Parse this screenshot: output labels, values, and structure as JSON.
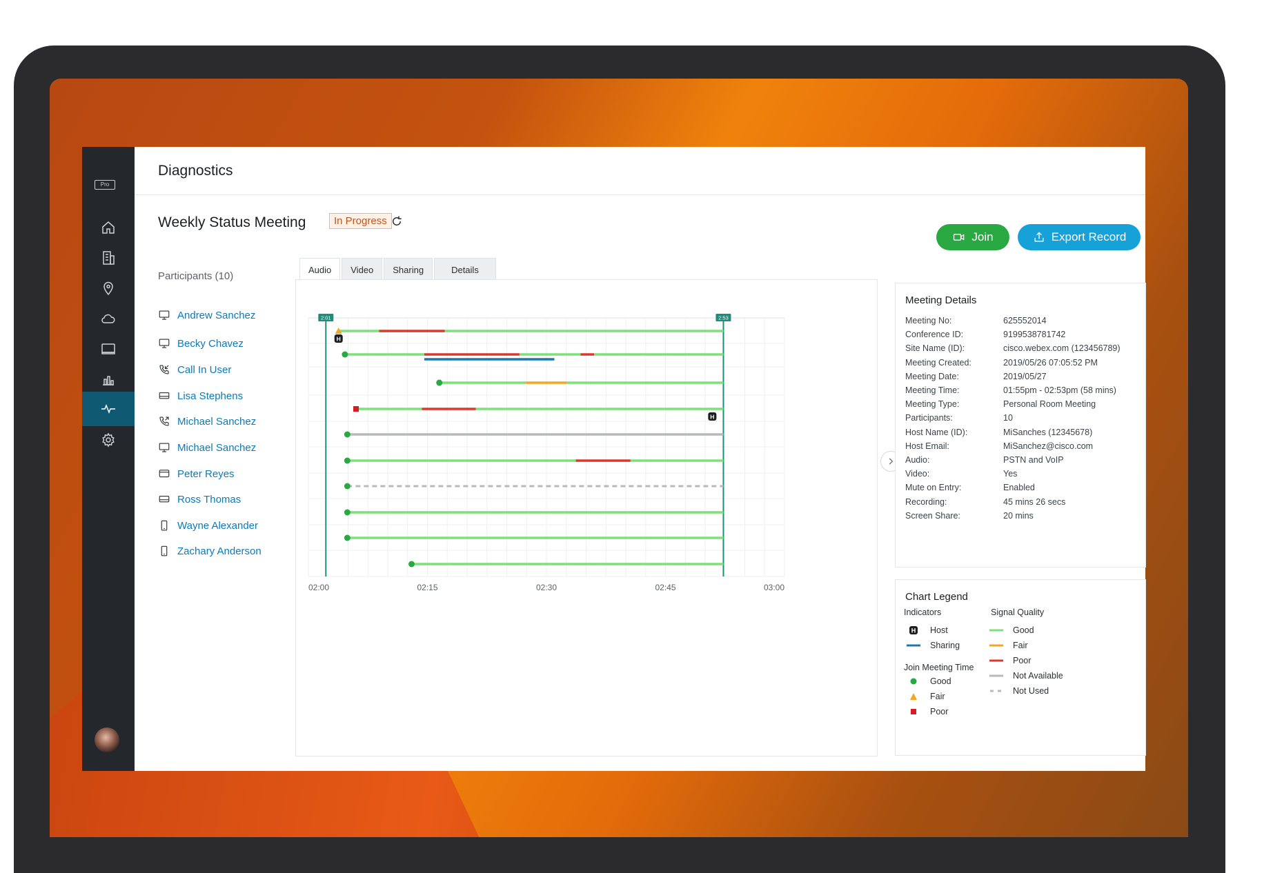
{
  "colors": {
    "good": "#7ee07a",
    "fair": "#f5a623",
    "poor": "#d73a2f",
    "not_available": "#b7b9bc",
    "sharing": "#1d77b0",
    "join_good": "#2aa841",
    "join_poor": "#d71c24",
    "marker": "#1f8c7c",
    "accent_blue": "#0d7ab8",
    "join_button": "#2aa841",
    "export_button": "#16a1d8",
    "nav_bg": "#24282c",
    "nav_active": "#0f5a72"
  },
  "nav": {
    "badge": "Pro",
    "items": [
      {
        "icon": "home-icon",
        "active": false
      },
      {
        "icon": "building-icon",
        "active": false
      },
      {
        "icon": "location-pin-icon",
        "active": false
      },
      {
        "icon": "cloud-icon",
        "active": false
      },
      {
        "icon": "monitor-icon",
        "active": false
      },
      {
        "icon": "bar-chart-icon",
        "active": false
      },
      {
        "icon": "pulse-icon",
        "active": true
      },
      {
        "icon": "gear-icon",
        "active": false
      }
    ]
  },
  "header": {
    "title": "Diagnostics"
  },
  "meeting": {
    "title": "Weekly Status Meeting",
    "status": "In Progress",
    "join_label": "Join",
    "export_label": "Export Record"
  },
  "participants_heading": "Participants (10)",
  "participants": [
    {
      "name": "Andrew Sanchez",
      "icon": "desktop-icon"
    },
    {
      "name": "Becky Chavez",
      "icon": "desktop-icon"
    },
    {
      "name": "Call In User",
      "icon": "phone-incoming-icon"
    },
    {
      "name": "Lisa Stephens",
      "icon": "room-device-icon"
    },
    {
      "name": "Michael Sanchez",
      "icon": "phone-outgoing-icon"
    },
    {
      "name": "Michael Sanchez",
      "icon": "desktop-icon"
    },
    {
      "name": "Peter Reyes",
      "icon": "board-device-icon"
    },
    {
      "name": "Ross Thomas",
      "icon": "room-device-icon"
    },
    {
      "name": "Wayne Alexander",
      "icon": "mobile-icon"
    },
    {
      "name": "Zachary Anderson",
      "icon": "mobile-icon"
    }
  ],
  "tabs": [
    {
      "label": "Audio",
      "active": true
    },
    {
      "label": "Video",
      "active": false
    },
    {
      "label": "Sharing",
      "active": false
    },
    {
      "label": "Details",
      "active": false
    }
  ],
  "chart_data": {
    "type": "timeline",
    "x_domain_minutes": [
      0,
      60
    ],
    "x_ticks": [
      {
        "label": "02:00",
        "t": 0
      },
      {
        "label": "02:15",
        "t": 15
      },
      {
        "label": "02:30",
        "t": 30
      },
      {
        "label": "02:45",
        "t": 45
      },
      {
        "label": "03:00",
        "t": 60
      }
    ],
    "meeting_start": {
      "label": "2:01",
      "t": 2.2
    },
    "meeting_end": {
      "label": "2:53",
      "t": 52.3
    },
    "grid": true,
    "rows": [
      {
        "participant": "Andrew Sanchez",
        "join_t": 3.8,
        "join_quality": "fair",
        "host_t": 3.8,
        "segments": [
          {
            "t0": 3.8,
            "t1": 8.9,
            "q": "good"
          },
          {
            "t0": 8.9,
            "t1": 17.2,
            "q": "poor"
          },
          {
            "t0": 17.2,
            "t1": 52.3,
            "q": "good"
          }
        ]
      },
      {
        "participant": "Becky Chavez",
        "join_t": 4.6,
        "join_quality": "good",
        "segments": [
          {
            "t0": 4.6,
            "t1": 14.6,
            "q": "good"
          },
          {
            "t0": 14.6,
            "t1": 26.6,
            "q": "poor"
          },
          {
            "t0": 26.6,
            "t1": 34.3,
            "q": "good"
          },
          {
            "t0": 34.3,
            "t1": 36.0,
            "q": "poor"
          },
          {
            "t0": 36.0,
            "t1": 52.3,
            "q": "good"
          }
        ],
        "sharing": [
          {
            "t0": 14.6,
            "t1": 31.0
          }
        ]
      },
      {
        "participant": "Call In User",
        "join_t": 16.5,
        "join_quality": "good",
        "segments": [
          {
            "t0": 16.5,
            "t1": 27.4,
            "q": "good"
          },
          {
            "t0": 27.4,
            "t1": 32.6,
            "q": "fair"
          },
          {
            "t0": 32.6,
            "t1": 52.3,
            "q": "good"
          }
        ]
      },
      {
        "participant": "Lisa Stephens",
        "join_t": 6.0,
        "join_quality": "poor",
        "host_t": 50.9,
        "segments": [
          {
            "t0": 6.0,
            "t1": 14.3,
            "q": "good"
          },
          {
            "t0": 14.3,
            "t1": 21.1,
            "q": "poor"
          },
          {
            "t0": 21.1,
            "t1": 52.3,
            "q": "good"
          }
        ]
      },
      {
        "participant": "Michael Sanchez",
        "join_t": 4.9,
        "join_quality": "good",
        "segments": [
          {
            "t0": 4.9,
            "t1": 52.3,
            "q": "not_available"
          }
        ]
      },
      {
        "participant": "Michael Sanchez",
        "join_t": 4.9,
        "join_quality": "good",
        "segments": [
          {
            "t0": 4.9,
            "t1": 33.7,
            "q": "good"
          },
          {
            "t0": 33.7,
            "t1": 40.6,
            "q": "poor"
          },
          {
            "t0": 40.6,
            "t1": 52.3,
            "q": "good"
          }
        ]
      },
      {
        "participant": "Peter Reyes",
        "join_t": 4.9,
        "join_quality": "good",
        "segments": [
          {
            "t0": 4.9,
            "t1": 52.3,
            "q": "not_used"
          }
        ]
      },
      {
        "participant": "Ross Thomas",
        "join_t": 4.9,
        "join_quality": "good",
        "segments": [
          {
            "t0": 4.9,
            "t1": 52.3,
            "q": "good"
          }
        ]
      },
      {
        "participant": "Wayne Alexander",
        "join_t": 4.9,
        "join_quality": "good",
        "segments": [
          {
            "t0": 4.9,
            "t1": 52.3,
            "q": "good"
          }
        ]
      },
      {
        "participant": "Zachary Anderson",
        "join_t": 13.0,
        "join_quality": "good",
        "segments": [
          {
            "t0": 13.0,
            "t1": 52.3,
            "q": "good"
          }
        ]
      }
    ]
  },
  "details": {
    "title": "Meeting Details",
    "rows": [
      {
        "k": "Meeting No:",
        "v": "625552014"
      },
      {
        "k": "Conference ID:",
        "v": "9199538781742"
      },
      {
        "k": "Site Name (ID):",
        "v": "cisco.webex.com (123456789)"
      },
      {
        "k": "Meeting Created:",
        "v": "2019/05/26 07:05:52 PM"
      },
      {
        "k": "Meeting Date:",
        "v": "2019/05/27"
      },
      {
        "k": "Meeting Time:",
        "v": "01:55pm - 02:53pm (58 mins)"
      },
      {
        "k": "Meeting Type:",
        "v": "Personal Room Meeting"
      },
      {
        "k": "Participants:",
        "v": "10"
      },
      {
        "k": "Host Name (ID):",
        "v": "MiSanches (12345678)"
      },
      {
        "k": "Host Email:",
        "v": "MiSanchez@cisco.com"
      },
      {
        "k": "Audio:",
        "v": "PSTN and VoIP"
      },
      {
        "k": "Video:",
        "v": "Yes"
      },
      {
        "k": "Mute on Entry:",
        "v": "Enabled"
      },
      {
        "k": "Recording:",
        "v": "45 mins 26 secs"
      },
      {
        "k": "Screen Share:",
        "v": "20 mins"
      }
    ]
  },
  "legend": {
    "title": "Chart Legend",
    "indicators_title": "Indicators",
    "indicators": [
      {
        "label": "Host",
        "symbol": "host"
      },
      {
        "label": "Sharing",
        "symbol": "sharing"
      }
    ],
    "join_title": "Join Meeting Time",
    "join_items": [
      {
        "label": "Good",
        "symbol": "dot"
      },
      {
        "label": "Fair",
        "symbol": "triangle"
      },
      {
        "label": "Poor",
        "symbol": "square"
      }
    ],
    "signal_title": "Signal Quality",
    "signal_items": [
      {
        "label": "Good",
        "symbol": "good"
      },
      {
        "label": "Fair",
        "symbol": "fair"
      },
      {
        "label": "Poor",
        "symbol": "poor"
      },
      {
        "label": "Not Available",
        "symbol": "not_available"
      },
      {
        "label": "Not Used",
        "symbol": "not_used"
      }
    ],
    "host_glyph": "H"
  }
}
